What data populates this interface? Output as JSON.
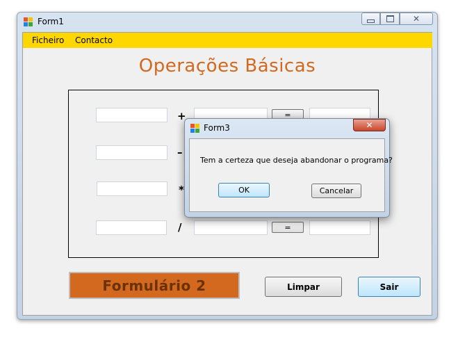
{
  "form1": {
    "title": "Form1",
    "menu": [
      "Ficheiro",
      "Contacto"
    ],
    "heading": "Operações Básicas",
    "rows": [
      {
        "operator": "+",
        "equals_label": "="
      },
      {
        "operator": "–",
        "equals_label": "="
      },
      {
        "operator": "*",
        "equals_label": "="
      },
      {
        "operator": "/",
        "equals_label": "="
      }
    ],
    "form2_button": "Formulário 2",
    "limpar_button": "Limpar",
    "sair_button": "Sair",
    "menubar_color": "#FFD700",
    "accent_color": "#D2691E"
  },
  "form3": {
    "title": "Form3",
    "message": "Tem a certeza que deseja abandonar o programa?",
    "ok_button": "OK",
    "cancel_button": "Cancelar"
  },
  "icons": {
    "window_app_icon": "app-icon",
    "minimize": "minimize-icon",
    "maximize": "maximize-icon",
    "close": "close-icon"
  }
}
